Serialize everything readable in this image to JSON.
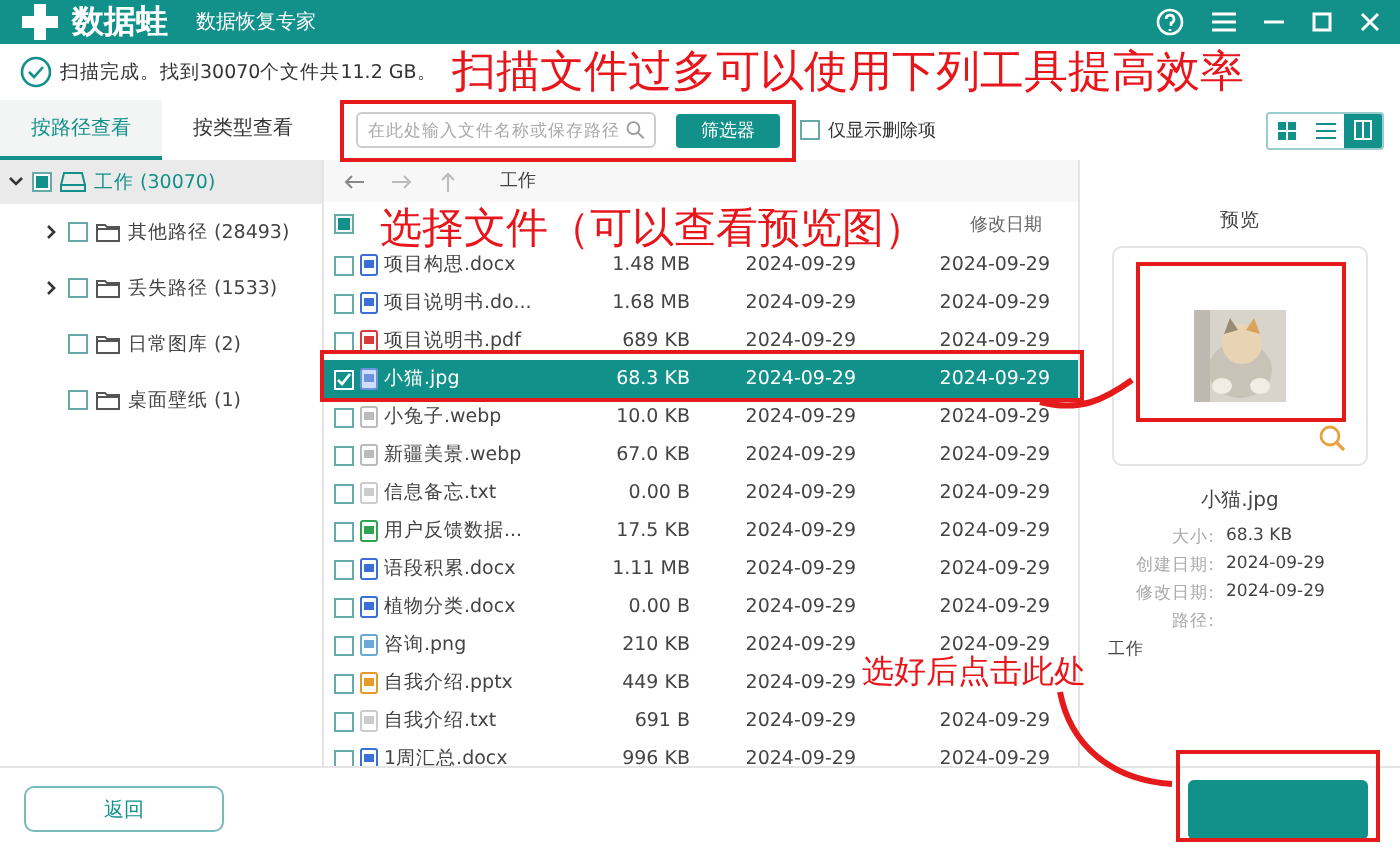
{
  "window": {
    "app_name": "数据蛙",
    "subtitle": "数据恢复专家"
  },
  "status": {
    "text": "扫描完成。找到30070个文件共11.2 GB。"
  },
  "sidebar": {
    "tabs": [
      {
        "label": "按路径查看",
        "selected": true
      },
      {
        "label": "按类型查看",
        "selected": false
      }
    ],
    "tree": [
      {
        "label": "工作 (30070)",
        "checked": false,
        "partial": true,
        "expanded": true,
        "selected": true,
        "children": [
          {
            "label": "其他路径 (28493)",
            "checked": false,
            "expanded": false,
            "has_children": true
          },
          {
            "label": "丢失路径 (1533)",
            "checked": false,
            "expanded": false,
            "has_children": true
          },
          {
            "label": "日常图库 (2)",
            "checked": false,
            "has_children": false
          },
          {
            "label": "桌面壁纸 (1)",
            "checked": false,
            "has_children": false
          }
        ]
      }
    ]
  },
  "toolbar": {
    "search": {
      "placeholder": "在此处输入文件名称或保存路径"
    },
    "filter_button": "筛选器",
    "deleted_only": {
      "label": "仅显示删除项",
      "checked": false
    },
    "views": [
      {
        "kind": "grid",
        "selected": false
      },
      {
        "kind": "list",
        "selected": false
      },
      {
        "kind": "detail",
        "selected": true
      }
    ]
  },
  "path": {
    "current": "工作"
  },
  "table": {
    "header": {
      "checked": false,
      "partial": true,
      "column_4": "修改日期"
    },
    "rows": [
      {
        "kind": "word",
        "name": "项目构思.docx",
        "size": "1.48 MB",
        "created": "2024-09-29",
        "modified": "2024-09-29",
        "checked": false,
        "selected": false
      },
      {
        "kind": "word",
        "name": "项目说明书.do...",
        "size": "1.68 MB",
        "created": "2024-09-29",
        "modified": "2024-09-29",
        "checked": false,
        "selected": false
      },
      {
        "kind": "pdf",
        "name": "项目说明书.pdf",
        "size": "689 KB",
        "created": "2024-09-29",
        "modified": "2024-09-29",
        "checked": false,
        "selected": false
      },
      {
        "name": "小猫.jpg",
        "size": "68.3 KB",
        "created": "2024-09-29",
        "modified": "2024-09-29",
        "checked": true,
        "selected": true
      },
      {
        "kind": "webp",
        "name": "小兔子.webp",
        "size": "10.0 KB",
        "created": "2024-09-29",
        "modified": "2024-09-29",
        "checked": false,
        "selected": false
      },
      {
        "kind": "webp",
        "name": "新疆美景.webp",
        "size": "67.0 KB",
        "created": "2024-09-29",
        "modified": "2024-09-29",
        "checked": false,
        "selected": false
      },
      {
        "kind": "text",
        "name": "信息备忘.txt",
        "size": "0.00  B",
        "created": "2024-09-29",
        "modified": "2024-09-29",
        "checked": false,
        "selected": false
      },
      {
        "kind": "excel",
        "name": "用户反馈数据...",
        "size": "17.5 KB",
        "created": "2024-09-29",
        "modified": "2024-09-29",
        "checked": false,
        "selected": false
      },
      {
        "kind": "word",
        "name": "语段积累.docx",
        "size": "1.11 MB",
        "created": "2024-09-29",
        "modified": "2024-09-29",
        "checked": false,
        "selected": false
      },
      {
        "kind": "word",
        "name": "植物分类.docx",
        "size": "0.00  B",
        "created": "2024-09-29",
        "modified": "2024-09-29",
        "checked": false,
        "selected": false
      },
      {
        "kind": "png",
        "name": "咨询.png",
        "size": "210 KB",
        "created": "2024-09-29",
        "modified": "2024-09-29",
        "checked": false,
        "selected": false
      },
      {
        "kind": "ppt",
        "name": "自我介绍.pptx",
        "size": "449 KB",
        "created": "2024-09-29",
        "checked": false,
        "selected": false
      },
      {
        "kind": "text",
        "name": "自我介绍.txt",
        "size": "691  B",
        "created": "2024-09-29",
        "modified": "2024-09-29",
        "checked": false,
        "selected": false
      },
      {
        "kind": "word",
        "name": "1周汇总.docx",
        "size": "996 KB",
        "created": "2024-09-29",
        "modified": "2024-09-29",
        "checked": false,
        "selected": false
      }
    ]
  },
  "preview": {
    "title": "预览",
    "file_name": "小猫.jpg",
    "details": [
      {
        "label": "大小:",
        "value": "68.3 KB"
      },
      {
        "label": "创建日期:",
        "value": "2024-09-29"
      },
      {
        "label": "修改日期:",
        "value": "2024-09-29"
      },
      {
        "label": "路径:"
      }
    ],
    "path_value": "工作"
  },
  "footer": {
    "back_button": "返回"
  },
  "annotations": [
    {
      "kind": "text",
      "text": "扫描文件过多可以使用下列工具提高效率"
    },
    {
      "kind": "frame"
    },
    {
      "kind": "text",
      "text": "选择文件（可以查看预览图）"
    },
    {
      "kind": "frame"
    },
    {
      "kind": "frame"
    },
    {
      "kind": "arrow"
    },
    {
      "kind": "text",
      "text": "选好后点击此处"
    },
    {
      "kind": "arrow"
    },
    {
      "kind": "frame"
    }
  ]
}
